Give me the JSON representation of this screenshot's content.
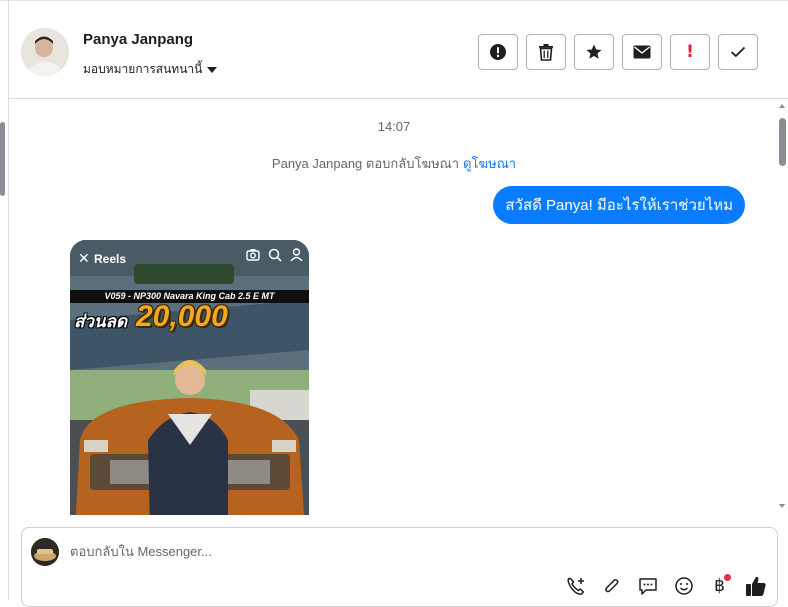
{
  "header": {
    "contact_name": "Panya Janpang",
    "assign_label": "มอบหมายการสนทนานี้"
  },
  "toolbar": {
    "buttons": [
      {
        "name": "mark-spam",
        "icon": "alert-circle-icon"
      },
      {
        "name": "delete",
        "icon": "trash-icon"
      },
      {
        "name": "star",
        "icon": "star-icon"
      },
      {
        "name": "mark-unread",
        "icon": "envelope-icon"
      },
      {
        "name": "follow-up",
        "icon": "exclamation-icon",
        "glyph": "!"
      },
      {
        "name": "mark-done",
        "icon": "check-icon"
      }
    ]
  },
  "chat": {
    "timestamp": "14:07",
    "system_message": "Panya Janpang ตอบกลับโฆษณา",
    "system_link": "ดูโฆษณา",
    "outgoing_message": "สวัสดี Panya! มีอะไรให้เราช่วยไหม",
    "reel": {
      "label": "Reels",
      "banner": "V059 - NP300 Navara King Cab 2.5 E MT",
      "promo_prefix": "ส่วนลด",
      "promo_amount": "20,000"
    }
  },
  "composer": {
    "placeholder": "ตอบกลับใน Messenger...",
    "baht_symbol": "฿"
  },
  "colors": {
    "accent": "#0a7cff",
    "link": "#1877f2",
    "alert": "#e41e3f",
    "promo": "#f5a623"
  }
}
